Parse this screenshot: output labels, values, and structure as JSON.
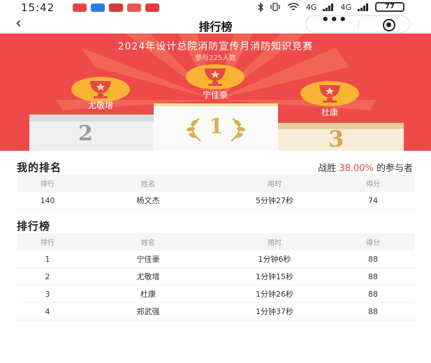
{
  "status_bar": {
    "time": "15:42",
    "network": "4G",
    "battery": "77",
    "app_icons": [
      {
        "name": "app-icon-1",
        "color": "#e64545"
      },
      {
        "name": "app-icon-2",
        "color": "#2f7ae0"
      },
      {
        "name": "app-icon-3",
        "color": "#d83a3a"
      },
      {
        "name": "app-icon-4",
        "color": "#e85a4f"
      },
      {
        "name": "app-icon-5",
        "color": "#e23b3b"
      }
    ]
  },
  "nav": {
    "back_icon": "‹",
    "title": "排行榜",
    "more_icon": "•••",
    "close_icon": "target-circle"
  },
  "banner": {
    "title": "2024年设计总院消防宣传月消防知识竞赛",
    "participants": "参与225人数",
    "colors": {
      "bg": "#ee4a4a",
      "ray": "#f26a5a",
      "trophy": "#f7b533",
      "trophy_dark": "#e1921f",
      "star": "#ffe08a",
      "cup": "#e84848"
    },
    "podium": [
      {
        "rank": "2",
        "name": "尤敬增"
      },
      {
        "rank": "1",
        "name": "宁佳豪"
      },
      {
        "rank": "3",
        "name": "杜康"
      }
    ]
  },
  "my_rank": {
    "title": "我的排名",
    "beat_prefix": "战胜",
    "beat_pct": "38.00%",
    "beat_suffix": "的参与者",
    "headers": [
      "排行",
      "姓名",
      "用时",
      "得分"
    ],
    "row": {
      "rank": "140",
      "name": "杨文杰",
      "time": "5分钟27秒",
      "score": "74"
    }
  },
  "leaderboard": {
    "title": "排行榜",
    "headers": [
      "排行",
      "姓名",
      "用时",
      "得分"
    ],
    "rows": [
      {
        "rank": "1",
        "name": "宁佳豪",
        "time": "1分钟6秒",
        "score": "88"
      },
      {
        "rank": "2",
        "name": "尤敬增",
        "time": "1分钟15秒",
        "score": "88"
      },
      {
        "rank": "3",
        "name": "杜康",
        "time": "1分钟26秒",
        "score": "88"
      },
      {
        "rank": "4",
        "name": "郑武强",
        "time": "1分钟37秒",
        "score": "88"
      }
    ]
  }
}
